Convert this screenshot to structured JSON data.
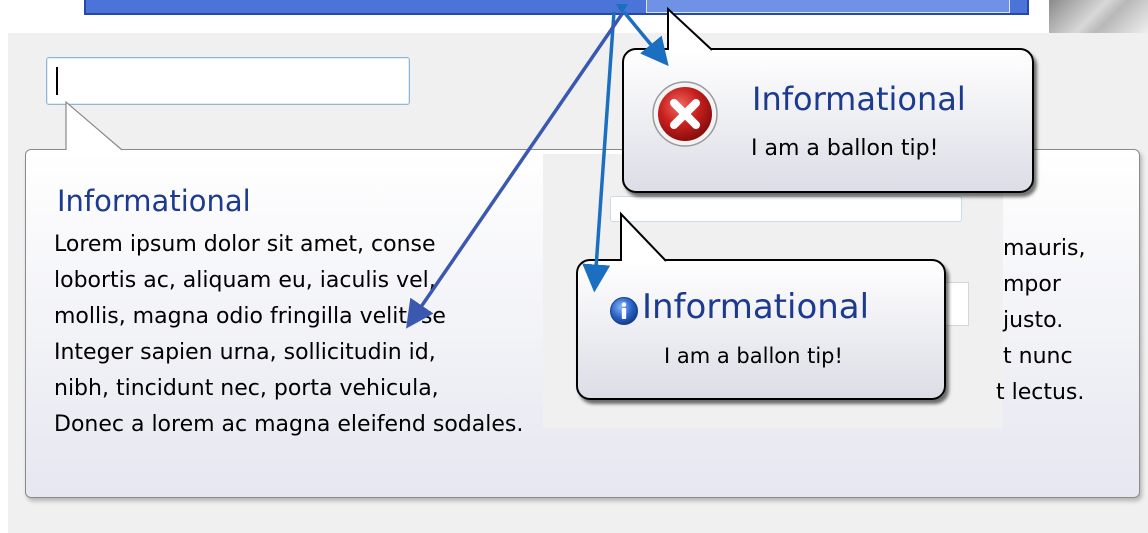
{
  "main_balloon": {
    "title": "Informational",
    "lines": [
      "Lorem ipsum dolor sit amet, conse",
      "lobortis ac, aliquam eu, iaculis vel,",
      "mollis, magna odio fringilla velit, se",
      "Integer sapien urna, sollicitudin id,",
      "nibh, tincidunt nec, porta vehicula,",
      "Donec a lorem ac magna eleifend sodales."
    ],
    "right_fragments": [
      "mauris,",
      "mpor",
      "justo.",
      "t nunc",
      "t lectus."
    ]
  },
  "error_balloon": {
    "title": "Informational",
    "text": "I am a ballon tip!",
    "icon": "error-icon"
  },
  "info_balloon": {
    "title": "Informational",
    "text": "I am a ballon tip!",
    "icon": "info-icon"
  },
  "colors": {
    "title_blue": "#1c3a8f",
    "header_blue": "#4a74d8",
    "arrow_blue": "#1a6fc0",
    "arrow_indigo": "#3a58b0",
    "error_red": "#c8201e",
    "info_blue": "#2a63c9"
  }
}
